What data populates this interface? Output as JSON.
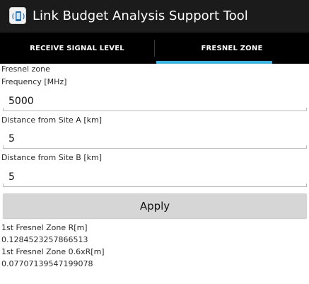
{
  "app": {
    "title": "Link Budget Analysis Support Tool",
    "icon": "phone-signal-icon"
  },
  "tabs": [
    {
      "label": "RECEIVE SIGNAL LEVEL",
      "selected": false
    },
    {
      "label": "FRESNEL ZONE",
      "selected": true
    }
  ],
  "colors": {
    "actionbar": "#1b1b1b",
    "tabbar": "#000000",
    "tab_indicator": "#33b5e5",
    "button": "#d6d6d6"
  },
  "form": {
    "section_title": "Fresnel zone",
    "frequency_label": "Frequency [MHz]",
    "frequency_value": "5000",
    "distance_a_label": "Distance from Site A [km]",
    "distance_a_value": "5",
    "distance_b_label": "Distance from Site B [km]",
    "distance_b_value": "5",
    "apply_label": "Apply"
  },
  "results": {
    "r_label": "1st Fresnel Zone R[m]",
    "r_value": "0.1284523257866513",
    "r06_label": "1st Fresnel Zone 0.6xR[m]",
    "r06_value": "0.07707139547199078"
  }
}
